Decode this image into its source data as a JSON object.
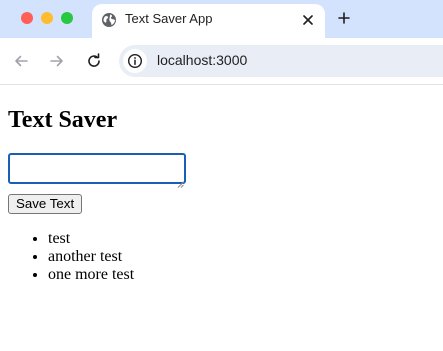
{
  "browser": {
    "tab": {
      "title": "Text Saver App",
      "favicon": "globe-icon"
    },
    "new_tab_icon": "plus-icon",
    "toolbar": {
      "back_icon": "arrow-left-icon",
      "forward_icon": "arrow-right-icon",
      "reload_icon": "reload-icon",
      "site_info_icon": "info-icon",
      "url": "localhost:3000"
    },
    "colors": {
      "tabstrip": "#d3e3fd",
      "omnibox": "#e9eef6",
      "close": "#ff5f57",
      "minimize": "#febc2e",
      "zoom": "#28c840",
      "input_focus": "#1a5fb4"
    }
  },
  "page": {
    "title": "Text Saver",
    "input": {
      "value": "",
      "placeholder": ""
    },
    "save_button_label": "Save Text",
    "saved_items": [
      "test",
      "another test",
      "one more test"
    ]
  }
}
